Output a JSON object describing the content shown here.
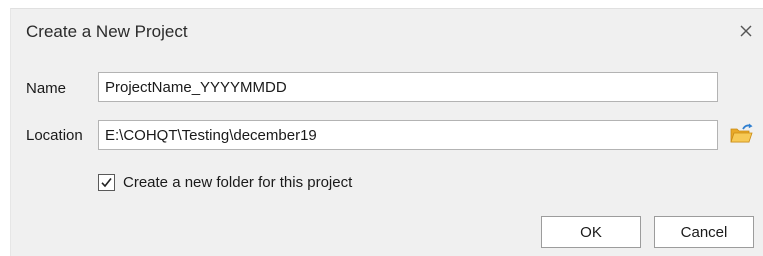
{
  "dialog": {
    "title": "Create a New Project",
    "close_icon": "close-icon"
  },
  "form": {
    "name_label": "Name",
    "name_value": "ProjectName_YYYYMMDD",
    "location_label": "Location",
    "location_value": "E:\\COHQT\\Testing\\december19",
    "browse_icon": "folder-browse-icon",
    "create_folder_label": "Create a new folder for this project",
    "create_folder_checked": true
  },
  "buttons": {
    "ok_label": "OK",
    "cancel_label": "Cancel"
  },
  "colors": {
    "dialog_background": "#f0f0f0",
    "folder_icon_fill": "#f2b63c",
    "folder_arrow": "#2f7fd1"
  }
}
